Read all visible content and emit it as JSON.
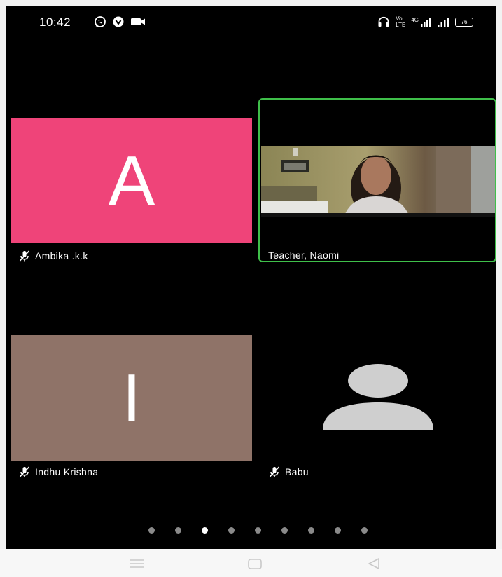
{
  "status_bar": {
    "time": "10:42",
    "left_icons": [
      "whatsapp-icon",
      "vpn-shield-icon",
      "video-camera-icon"
    ],
    "right_icons": [
      "headphones-icon",
      "volte-icon",
      "4g-signal-icon",
      "signal-icon"
    ],
    "network_label_top": "Vo",
    "network_label_bottom": "LTE",
    "signal_label": "4G",
    "battery": "76"
  },
  "participants": [
    {
      "name": "Ambika .k.k",
      "initial": "A",
      "color": "#ef4479",
      "muted": true
    },
    {
      "name": "Teacher, Naomi",
      "initial": "",
      "video": true,
      "active_speaker": true,
      "muted": false
    },
    {
      "name": "Indhu Krishna",
      "initial": "I",
      "color": "#8f7368",
      "muted": true
    },
    {
      "name": "Babu",
      "initial": "",
      "avatar": "person-silhouette-icon",
      "muted": true
    }
  ],
  "pagination": {
    "total_pages": 9,
    "current_page": 3
  },
  "colors": {
    "background": "#000000",
    "active_speaker_border": "#3fbf4a",
    "dot_inactive": "#8a8a8a",
    "dot_active": "#ffffff"
  },
  "nav_bar": {
    "buttons": [
      "menu-icon",
      "home-square-icon",
      "back-triangle-icon"
    ]
  }
}
